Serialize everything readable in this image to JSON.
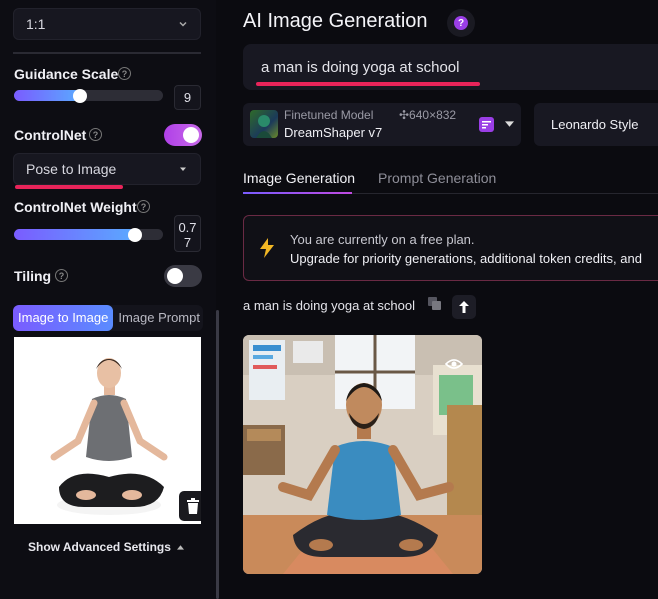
{
  "sidebar": {
    "aspect_select": {
      "value": "1:1"
    },
    "guidance_scale": {
      "label": "Guidance Scale",
      "value": "9",
      "level_fraction": 0.4
    },
    "controlnet": {
      "label": "ControlNet",
      "enabled": true,
      "mode_value": "Pose to Image"
    },
    "controlnet_weight": {
      "label": "ControlNet Weight",
      "value_line1": "0.7",
      "value_line2": "7",
      "level_fraction": 0.77
    },
    "tiling": {
      "label": "Tiling",
      "enabled": false
    },
    "image_tabs": [
      {
        "label": "Image to Image",
        "active": true
      },
      {
        "label": "Image Prompt",
        "active": false
      }
    ],
    "advanced_settings": {
      "label": "Show Advanced Settings"
    }
  },
  "main": {
    "title": "AI Image Generation",
    "help_glyph": "?",
    "prompt": {
      "value": "a man is doing yoga at school"
    },
    "model": {
      "caption": "Finetuned Model",
      "name": "DreamShaper v7",
      "dimensions": "✣640×832"
    },
    "style": {
      "value": "Leonardo Style"
    },
    "tabs": [
      {
        "label": "Image Generation",
        "active": true
      },
      {
        "label": "Prompt Generation",
        "active": false
      }
    ],
    "banner": {
      "line1": "You are currently on a free plan.",
      "line2": "Upgrade for priority generations, additional token credits, and"
    },
    "generation": {
      "prompt_text": "a man is doing yoga at school"
    }
  },
  "colors": {
    "accent_gradient_start": "#7a5cff",
    "accent_gradient_end": "#5aa9ff",
    "highlight_red": "#e8245a",
    "toggle_on": "#b040e8"
  }
}
